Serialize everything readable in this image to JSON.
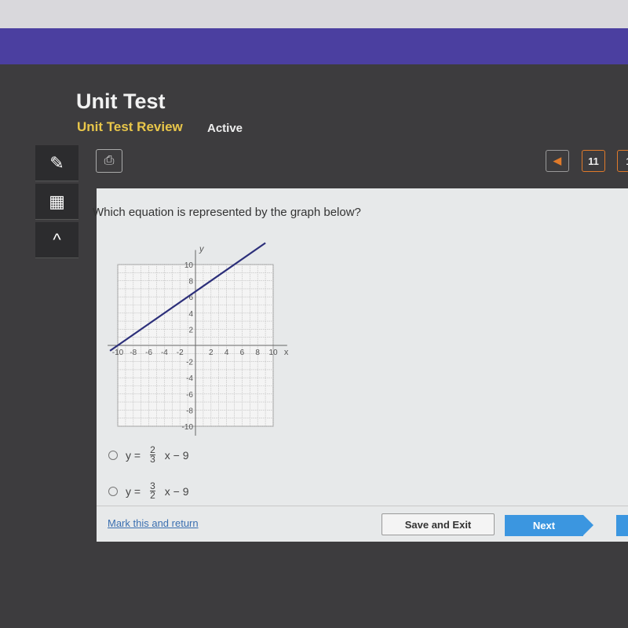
{
  "header": {
    "title": "Unit Test",
    "subtitle": "Unit Test Review",
    "status": "Active"
  },
  "toolbar": {
    "tools": [
      {
        "icon": "pencil-icon",
        "glyph": "✎"
      },
      {
        "icon": "calculator-icon",
        "glyph": "▦"
      },
      {
        "icon": "caret-up-icon",
        "glyph": "^"
      }
    ],
    "print_glyph": "⎙"
  },
  "navigation": {
    "prev_glyph": "◀",
    "current_page": "11",
    "next_page_partial": "1",
    "accent": "#e07a2a"
  },
  "question": {
    "text": "Which equation is represented by the graph below?"
  },
  "chart_data": {
    "type": "line",
    "xlabel": "x",
    "ylabel": "y",
    "xlim": [
      -10,
      10
    ],
    "ylim": [
      -10,
      10
    ],
    "grid": true,
    "xticks": [
      "-10",
      "-8",
      "-6",
      "-4",
      "-2",
      "2",
      "4",
      "6",
      "8",
      "10"
    ],
    "yticks": [
      "10",
      "8",
      "6",
      "4",
      "2",
      "-2",
      "-4",
      "-6",
      "-8",
      "-10"
    ],
    "series": [
      {
        "points": [
          [
            -11,
            -0.67
          ],
          [
            9,
            12.67
          ]
        ],
        "color": "#2c2f7a"
      }
    ]
  },
  "choices": [
    {
      "lhs": "y =",
      "num": "2",
      "den": "3",
      "rhs": "x − 9"
    },
    {
      "lhs": "y =",
      "num": "3",
      "den": "2",
      "rhs": "x − 9"
    }
  ],
  "footer": {
    "mark_label": "Mark this and return",
    "save_label": "Save and Exit",
    "next_label": "Next"
  }
}
